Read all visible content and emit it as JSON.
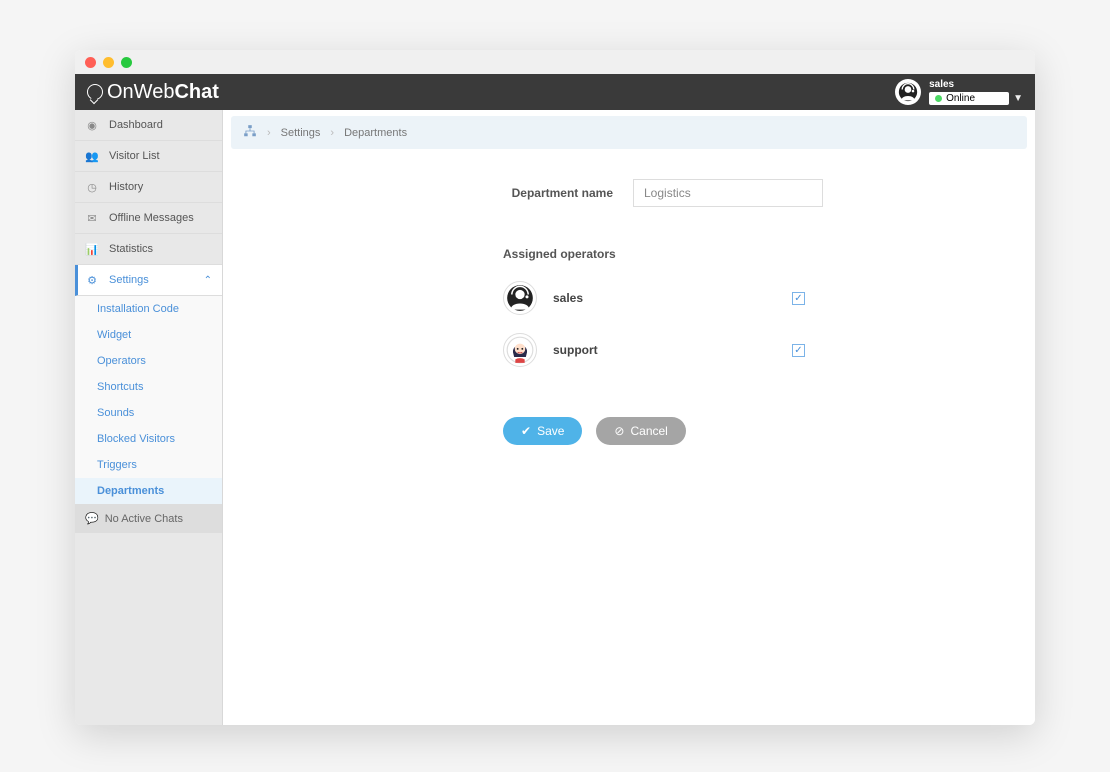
{
  "app": {
    "name_prefix": "OnWeb",
    "name_suffix": "Chat"
  },
  "user": {
    "name": "sales",
    "status": "Online"
  },
  "sidebar": {
    "items": [
      {
        "label": "Dashboard",
        "icon": "dashboard"
      },
      {
        "label": "Visitor List",
        "icon": "users"
      },
      {
        "label": "History",
        "icon": "clock"
      },
      {
        "label": "Offline Messages",
        "icon": "mail"
      },
      {
        "label": "Statistics",
        "icon": "stats"
      },
      {
        "label": "Settings",
        "icon": "gear"
      }
    ],
    "settings_sub": [
      {
        "label": "Installation Code"
      },
      {
        "label": "Widget"
      },
      {
        "label": "Operators"
      },
      {
        "label": "Shortcuts"
      },
      {
        "label": "Sounds"
      },
      {
        "label": "Blocked Visitors"
      },
      {
        "label": "Triggers"
      },
      {
        "label": "Departments"
      }
    ],
    "chat_status": "No Active Chats"
  },
  "breadcrumb": {
    "l1": "Settings",
    "l2": "Departments"
  },
  "form": {
    "dept_label": "Department name",
    "dept_value": "Logistics",
    "operators_title": "Assigned operators",
    "operators": [
      {
        "name": "sales",
        "checked": true
      },
      {
        "name": "support",
        "checked": true
      }
    ],
    "save": "Save",
    "cancel": "Cancel"
  }
}
